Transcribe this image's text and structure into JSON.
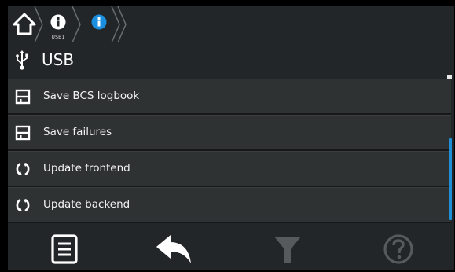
{
  "breadcrumb": {
    "items": [
      {
        "name": "home",
        "icon": "home-icon"
      },
      {
        "name": "info",
        "icon": "info-icon",
        "sublabel": "USB1"
      },
      {
        "name": "info-active",
        "icon": "info-icon",
        "color": "#1a8fe0"
      }
    ]
  },
  "header": {
    "icon": "usb-icon",
    "title": "USB"
  },
  "menu": {
    "items": [
      {
        "label": "Save BCS logbook",
        "icon": "floppy-disk-icon"
      },
      {
        "label": "Save failures",
        "icon": "floppy-disk-icon"
      },
      {
        "label": "Update frontend",
        "icon": "refresh-icon"
      },
      {
        "label": "Update backend",
        "icon": "refresh-icon"
      }
    ]
  },
  "bottom_bar": {
    "buttons": [
      {
        "name": "list",
        "icon": "document-list-icon",
        "enabled": true
      },
      {
        "name": "back",
        "icon": "back-arrow-icon",
        "enabled": true
      },
      {
        "name": "filter",
        "icon": "filter-icon",
        "enabled": false
      },
      {
        "name": "help",
        "icon": "help-icon",
        "enabled": false
      }
    ]
  },
  "colors": {
    "accent": "#1a8fe0",
    "background": "#232628",
    "row": "#2f3233",
    "disabled_icon": "#575a5c"
  }
}
